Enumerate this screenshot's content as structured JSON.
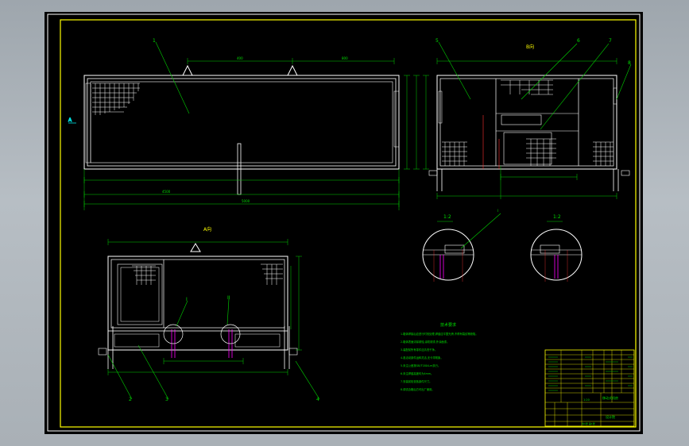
{
  "views": {
    "view_a_label": "A向",
    "view_b_label": "B向",
    "arrow_a_left": "A",
    "arrow_b_right": "B"
  },
  "callouts": {
    "top_view": [
      "1"
    ],
    "side_view": [
      "5",
      "6",
      "7",
      "8"
    ],
    "section_view": [
      "2",
      "3",
      "4"
    ],
    "detail_marks": [
      "I",
      "II"
    ]
  },
  "detail_labels": {
    "detail_1": "I",
    "detail_2": "II",
    "detail_ratio_1": "1:2",
    "detail_ratio_2": "1:2"
  },
  "notes": {
    "title": "技术要求",
    "lines": [
      "1.箱体焊接后应进行时效处理,焊缝应平整光滑,不得有裂纹等缺陷。",
      "2.箱体表面清除锈蚀,涂防锈漆,外涂面漆。",
      "3.装配前所有零件应清洗干净。",
      "4.各活动部件运转灵活,无卡滞现象。",
      "5.未注公差按GB/T1804-m执行。",
      "6.未注焊缝高度均为4mm。",
      "7.安装前检查各部件尺寸。",
      "8.调试合格后方可出厂使用。"
    ]
  },
  "title_block": {
    "drawing_title": "移动式机房",
    "company": "设计院",
    "scale": "1:20",
    "sheet": "共1张 第1张"
  }
}
